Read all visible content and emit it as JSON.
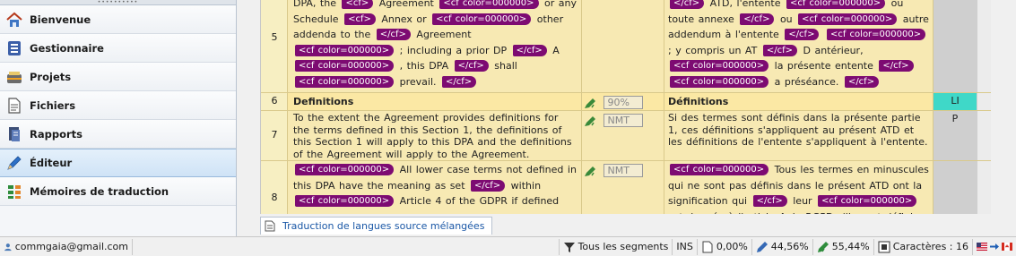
{
  "sidebar": {
    "items": [
      {
        "label": "Bienvenue",
        "icon": "home-icon"
      },
      {
        "label": "Gestionnaire",
        "icon": "manager-icon"
      },
      {
        "label": "Projets",
        "icon": "projects-icon"
      },
      {
        "label": "Fichiers",
        "icon": "files-icon"
      },
      {
        "label": "Rapports",
        "icon": "reports-icon"
      },
      {
        "label": "Éditeur",
        "icon": "editor-pen-icon"
      },
      {
        "label": "Mémoires de traduction",
        "icon": "translation-memory-icon"
      }
    ],
    "active_index": 5
  },
  "grid": {
    "rows": [
      {
        "num": "5",
        "source_parts": [
          "DPA, the",
          "<cf>",
          "Agreement",
          "<cf color=000000>",
          "or any Schedule",
          "<cf>",
          "Annex or",
          "<cf color=000000>",
          "other addenda to the",
          "</cf>",
          "Agreement",
          "<cf color=000000>",
          "; including a prior DP",
          "</cf>",
          "A",
          "<cf color=000000>",
          ", this DPA",
          "</cf>",
          "shall",
          "<cf color=000000>",
          "prevail.",
          "</cf>"
        ],
        "status": "",
        "target_parts": [
          "</cf>",
          "ATD, l'entente",
          "<cf color=000000>",
          "ou toute annexe",
          "</cf>",
          "ou",
          "<cf color=000000>",
          "autre addendum à l'entente",
          "</cf>",
          "<cf color=000000>",
          "; y compris un AT",
          "</cf>",
          "D antérieur,",
          "<cf color=000000>",
          "la présente entente",
          "</cf>",
          "<cf color=000000>",
          "a préséance.",
          "</cf>"
        ],
        "role": ""
      },
      {
        "num": "6",
        "source_text": "Definitions",
        "status": "90%",
        "target_text": "Définitions",
        "role": "LI"
      },
      {
        "num": "7",
        "source_text": "To the extent the Agreement provides definitions for the terms defined in this Section 1, the definitions of this Section 1 will apply to this DPA and the definitions of the Agreement will apply to the Agreement.",
        "status": "NMT",
        "target_text": "Si des termes sont définis dans la présente partie 1, ces définitions s'appliquent au présent ATD et les définitions de l'entente s'appliquent à l'entente.",
        "role": "P"
      },
      {
        "num": "8",
        "source_parts": [
          "<cf color=000000>",
          "All lower case terms not defined in this DPA have the meaning as set",
          "</cf>",
          "within",
          "<cf color=000000>",
          "Article 4 of the GDPR if defined"
        ],
        "status": "NMT",
        "target_parts": [
          "<cf color=000000>",
          "Tous les termes en minuscules qui ne sont pas définis dans le présent ATD ont la signification qui",
          "</cf>",
          "leur",
          "<cf color=000000>",
          "est donnée à l'article 4 du RGPD s'ils sont définis dans"
        ],
        "role": ""
      }
    ]
  },
  "tabs": [
    {
      "label": "Traduction de langues source mélangées"
    }
  ],
  "statusbar": {
    "user": "commgaia@gmail.com",
    "filter": "Tous les segments",
    "mode": "INS",
    "doc_pct": "0,00%",
    "edit_pct": "44,56%",
    "confirm_pct": "55,44%",
    "chars": "Caractères : 16"
  },
  "colors": {
    "tag_bg": "#7d0b72",
    "segment_bg": "#f7e9b3",
    "role_li": "#3fd8c8"
  }
}
